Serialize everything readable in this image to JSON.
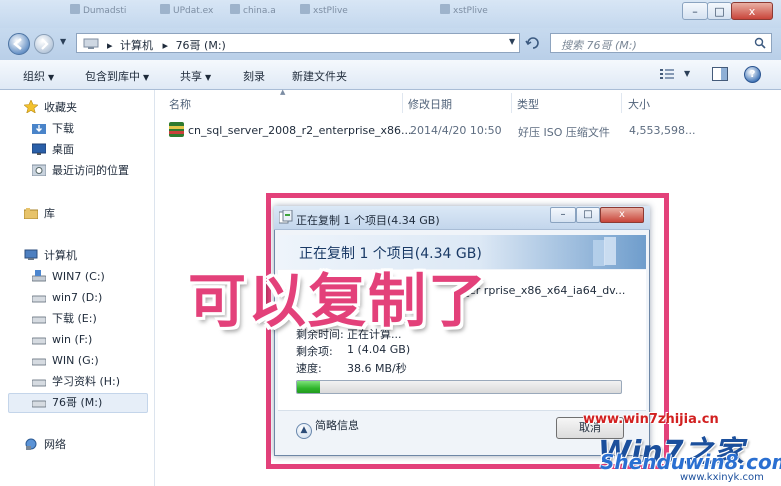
{
  "colors": {
    "accent_pink": "#e3417a",
    "progress_green": "#2fb52c",
    "watermark_red": "#d22020",
    "watermark_blue": "#1b4f9c"
  },
  "window": {
    "background_tabs": [
      "Dumadsti",
      "UPdat.ex",
      "china.a",
      "xstPlive"
    ],
    "controls": {
      "minimize": "–",
      "maximize": "□",
      "close": "x"
    }
  },
  "address": {
    "path": [
      "计算机",
      "76哥 (M:)"
    ],
    "separator": "▸",
    "refresh_icon": "refresh-icon"
  },
  "search": {
    "placeholder": "搜索 76哥 (M:)"
  },
  "toolbar": {
    "organize": "组织",
    "include_in_library": "包含到库中",
    "share": "共享",
    "burn": "刻录",
    "new_folder": "新建文件夹",
    "view_icon": "view-options-icon",
    "caret": "▼",
    "help": "?"
  },
  "sidebar": {
    "favorites": {
      "label": "收藏夹",
      "items": [
        "下载",
        "桌面",
        "最近访问的位置"
      ]
    },
    "libraries": {
      "label": "库"
    },
    "computer": {
      "label": "计算机",
      "drives": [
        "WIN7 (C:)",
        "win7 (D:)",
        "下载 (E:)",
        "win (F:)",
        "WIN (G:)",
        "学习资料 (H:)",
        "76哥 (M:)"
      ],
      "selected": "76哥 (M:)"
    },
    "network": {
      "label": "网络"
    }
  },
  "filelist": {
    "columns": [
      "名称",
      "修改日期",
      "类型",
      "大小"
    ],
    "rows": [
      {
        "name": "cn_sql_server_2008_r2_enterprise_x86...",
        "modified": "2014/4/20 10:50",
        "type": "好压 ISO 压缩文件",
        "size": "4,553,598..."
      }
    ]
  },
  "copy_dialog": {
    "title": "正在复制 1 个项目(4.34 GB)",
    "heading": "正在复制 1 个项目(4.34 GB)",
    "from_fragment": "G",
    "name_fragment": "r2_er   rprise_x86_x64_ia64_dv...",
    "time_remaining_label": "剩余时间:",
    "time_remaining_value": "正在计算...",
    "items_remaining_label": "剩余项:",
    "items_remaining_value": "1 (4.04 GB)",
    "speed_label": "速度:",
    "speed_value": "38.6 MB/秒",
    "progress": 0.07,
    "details_label": "简略信息",
    "cancel_label": "取消",
    "controls": {
      "minimize": "–",
      "maximize": "□",
      "close": "x"
    }
  },
  "caption": "可以复制了",
  "watermark": {
    "url1": "www.win7zhijia.cn",
    "brand_logo": "Win7之家",
    "brand_site": "Shenduwin8.com",
    "url2": "www.kxinyk.com"
  }
}
